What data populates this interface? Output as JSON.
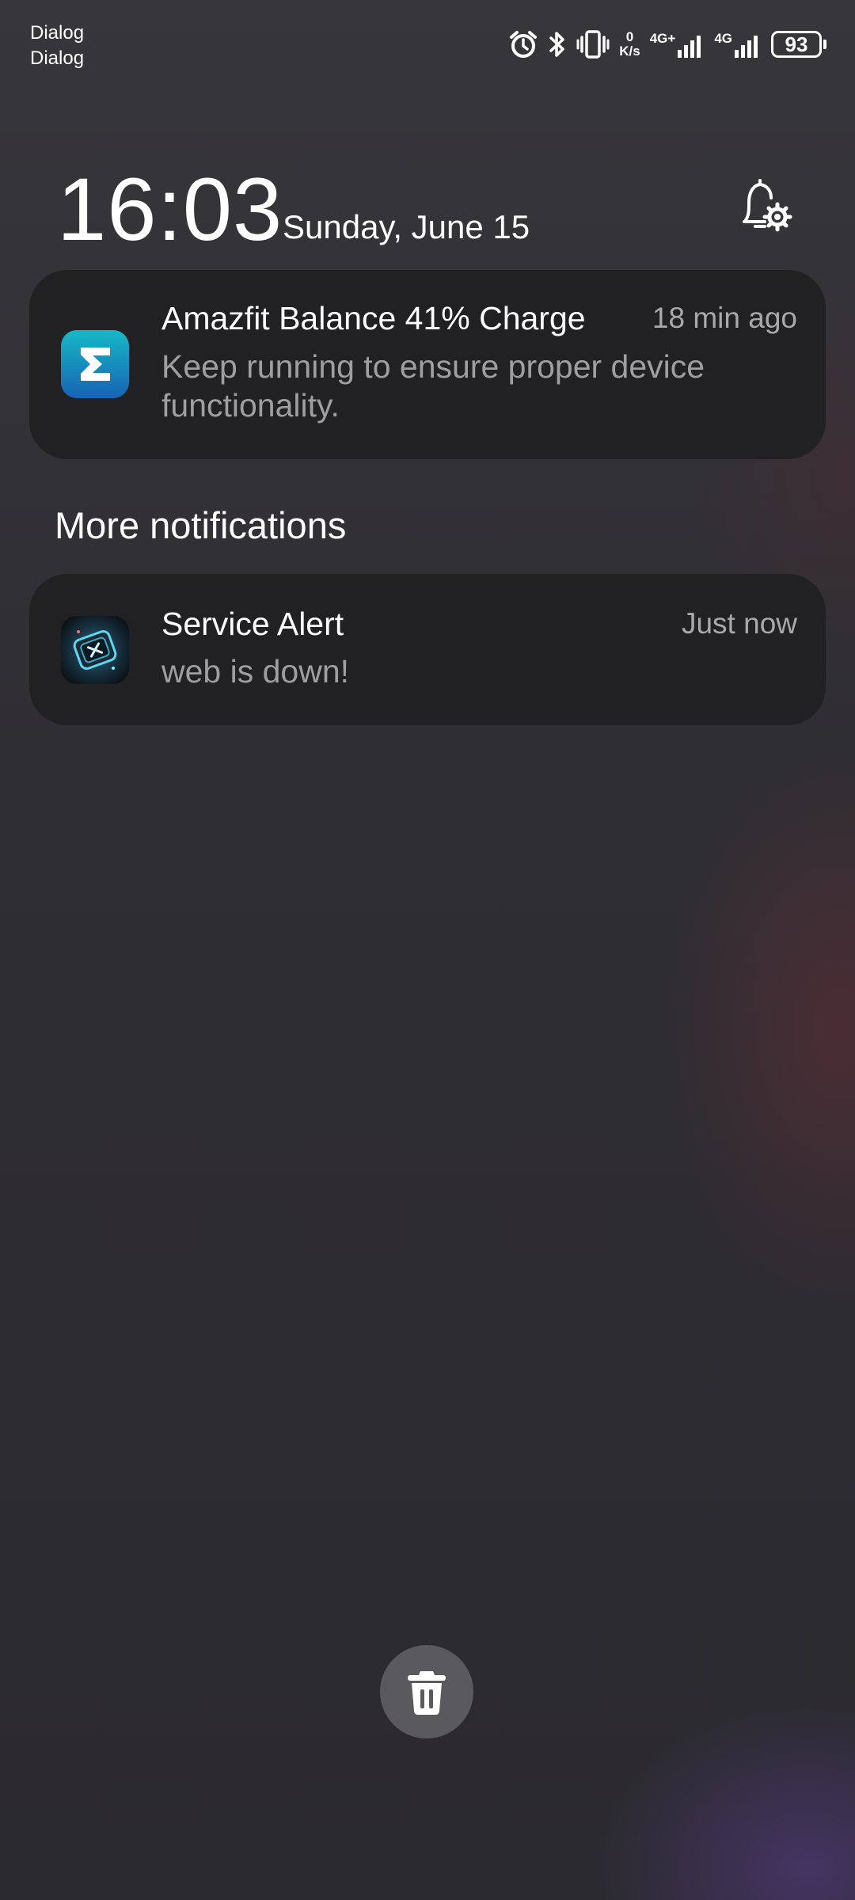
{
  "status_bar": {
    "left_lines": [
      "Dialog",
      "Dialog"
    ],
    "net_speed_value": "0",
    "net_speed_unit": "K/s",
    "sim1_tag": "4G+",
    "sim2_tag": "4G",
    "battery_level": "93",
    "icons": [
      "alarm-icon",
      "bluetooth-icon",
      "vibrate-icon",
      "signal-icon",
      "battery-icon"
    ]
  },
  "lockscreen": {
    "time": "16:03",
    "date": "Sunday, June 15"
  },
  "notifications": [
    {
      "app_icon": "amazfit-sigma-icon",
      "title": "Amazfit Balance 41% Charge",
      "time_ago": "18 min ago",
      "body": "Keep running to ensure proper device functionality."
    }
  ],
  "more": {
    "section_title": "More notifications",
    "items": [
      {
        "app_icon": "service-alert-icon",
        "title": "Service Alert",
        "time_ago": "Just now",
        "body": "web is down!"
      }
    ]
  },
  "colors": {
    "card_bg": "#212123",
    "amazfit_icon_top": "#17b8c6",
    "amazfit_icon_bottom": "#1763b4",
    "trash_button_bg": "#5a595e"
  }
}
